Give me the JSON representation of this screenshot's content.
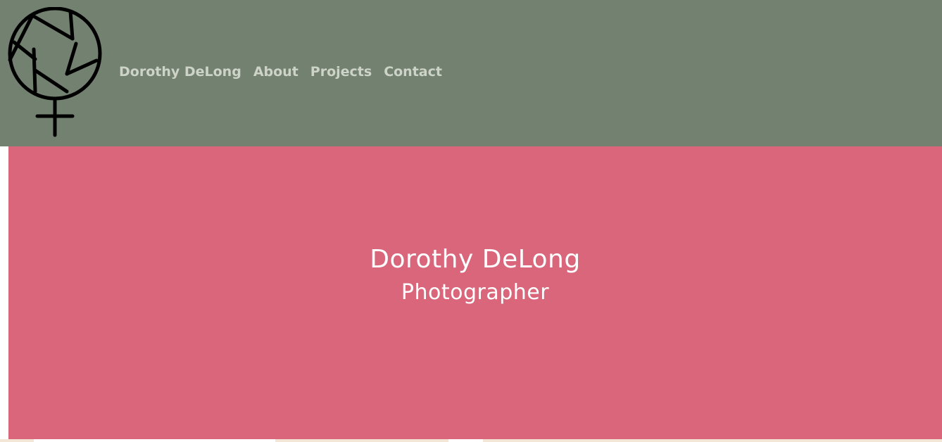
{
  "colors": {
    "header_bg": "#738170",
    "hero_bg": "#d9667a",
    "nav_text": "#cdd3c8",
    "hero_text": "#ffffff"
  },
  "logo": {
    "icon": "camera-aperture-venus-icon"
  },
  "nav": {
    "items": [
      {
        "label": "Dorothy DeLong"
      },
      {
        "label": "About"
      },
      {
        "label": "Projects"
      },
      {
        "label": "Contact"
      }
    ]
  },
  "hero": {
    "name": "Dorothy DeLong",
    "role": "Photographer"
  }
}
